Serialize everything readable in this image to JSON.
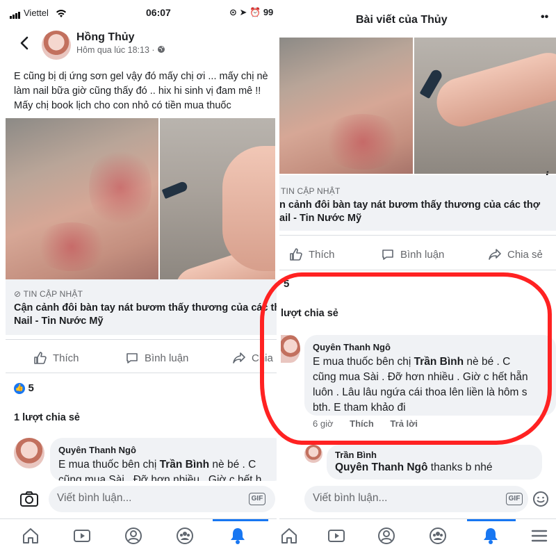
{
  "status_bar": {
    "carrier": "Viettel",
    "time": "06:07",
    "battery": "99"
  },
  "header": {
    "author": "Hồng Thủy",
    "timestamp": "Hôm qua lúc 18:13 ·",
    "right_title": "Bài viết của Thủy",
    "more": "••"
  },
  "post": {
    "lines": [
      "E cũng bị dị ứng sơn gel vậy đó mấy chị ơi ... mấy chị nè",
      "làm nail bữa giờ cũng thấy đó .. hix hi sinh vị đam mê !!",
      "Mấy chị book lịch cho con nhỏ có tiền mua thuốc"
    ]
  },
  "link": {
    "source": "TIN CẬP NHẬT",
    "title_line1": "Cận cảnh đôi bàn tay nát bươm thấy thương của các thợ",
    "title_line2": "Nail - Tin Nước Mỹ",
    "right_line1": "n cảnh đôi bàn tay nát bươm thấy thương của các thợ",
    "right_line2": "ail - Tin Nước Mỹ",
    "info": "i"
  },
  "actions": {
    "like": "Thích",
    "comment": "Bình luận",
    "share": "Chia sẻ",
    "share_cut": "Chia"
  },
  "reactions": {
    "count": "5",
    "shares": "1 lượt chia sẻ",
    "shares_cut": "lượt chia sẻ"
  },
  "comment1": {
    "author": "Quyên Thanh Ngô",
    "text_pre": "E mua thuốc bên chị ",
    "mention": "Trần Bình",
    "text_post": " nè bé . C",
    "line2": "cũng mua Sài . Đỡ hơn nhiều . Giờ c hết hẵn",
    "line3": "luôn . Lâu lâu ngứa cái thoa lên liền là hôm s",
    "line4": "bth. E tham khảo đi",
    "left_line2": "cũng mua Sài . Đỡ hơn nhiều . Giờ c hết h",
    "time": "6 giờ",
    "like": "Thích",
    "reply": "Trả lời"
  },
  "comment2": {
    "author": "Trần Bình",
    "mention": "Quyên Thanh Ngô",
    "text": " thanks b nhé"
  },
  "composer": {
    "placeholder": "Viết bình luận...",
    "gif": "GIF"
  },
  "icons": [
    "back-icon",
    "globe-icon",
    "like-icon",
    "comment-icon",
    "share-icon",
    "camera-icon",
    "emoji-icon",
    "home-icon",
    "video-icon",
    "profile-icon",
    "groups-icon",
    "bell-icon",
    "menu-icon"
  ],
  "colors": {
    "accent": "#1877f2",
    "annotation": "#ff2222",
    "text": "#1c1e21",
    "muted": "#65676b"
  }
}
